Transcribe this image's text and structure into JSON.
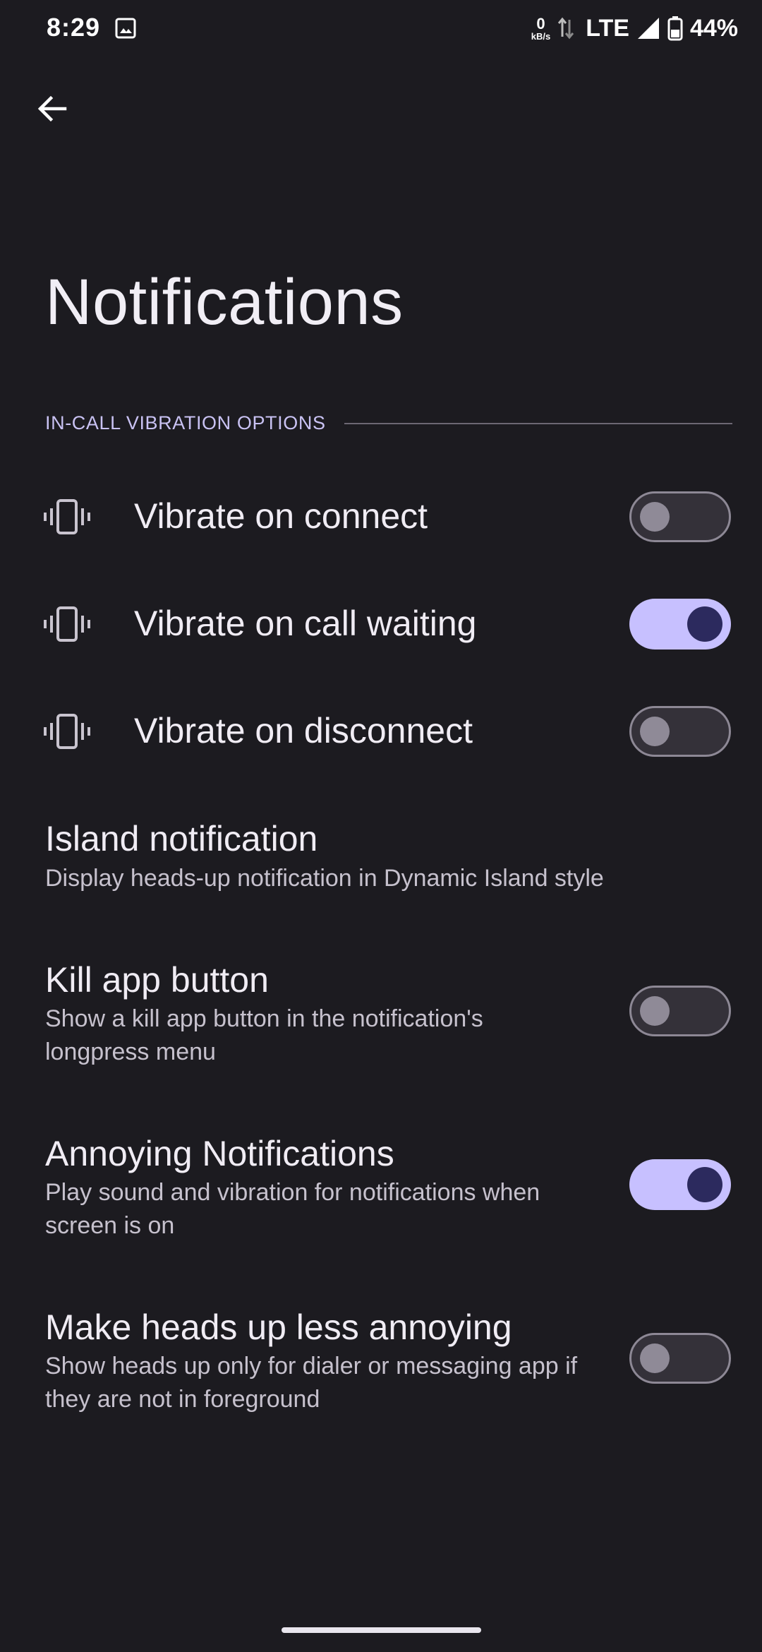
{
  "status_bar": {
    "time": "8:29",
    "net_speed_value": "0",
    "net_speed_unit": "kB/s",
    "network": "LTE",
    "battery": "44%",
    "icons": [
      "gallery-icon",
      "data-arrows-icon",
      "signal-icon",
      "battery-icon"
    ]
  },
  "header": {
    "back_icon": "arrow-left-icon",
    "title": "Notifications"
  },
  "section": {
    "label": "IN-CALL VIBRATION OPTIONS"
  },
  "vibration_options": [
    {
      "icon": "vibrate-icon",
      "label": "Vibrate on connect",
      "enabled": false
    },
    {
      "icon": "vibrate-icon",
      "label": "Vibrate on call waiting",
      "enabled": true
    },
    {
      "icon": "vibrate-icon",
      "label": "Vibrate on disconnect",
      "enabled": false
    }
  ],
  "settings": [
    {
      "title": "Island notification",
      "description": "Display heads-up notification in Dynamic Island style",
      "has_toggle": false
    },
    {
      "title": "Kill app button",
      "description": "Show a kill app button in the notification's longpress menu",
      "has_toggle": true,
      "enabled": false
    },
    {
      "title": "Annoying Notifications",
      "description": "Play sound and vibration for notifications when screen is on",
      "has_toggle": true,
      "enabled": true
    },
    {
      "title": "Make heads up less annoying",
      "description": "Show heads up only for dialer or messaging app if they are not in foreground",
      "has_toggle": true,
      "enabled": false
    }
  ],
  "colors": {
    "background": "#1c1b20",
    "accent": "#c7c0ff",
    "knob_on": "#2c2a5e",
    "section_label": "#c9c2f3"
  }
}
